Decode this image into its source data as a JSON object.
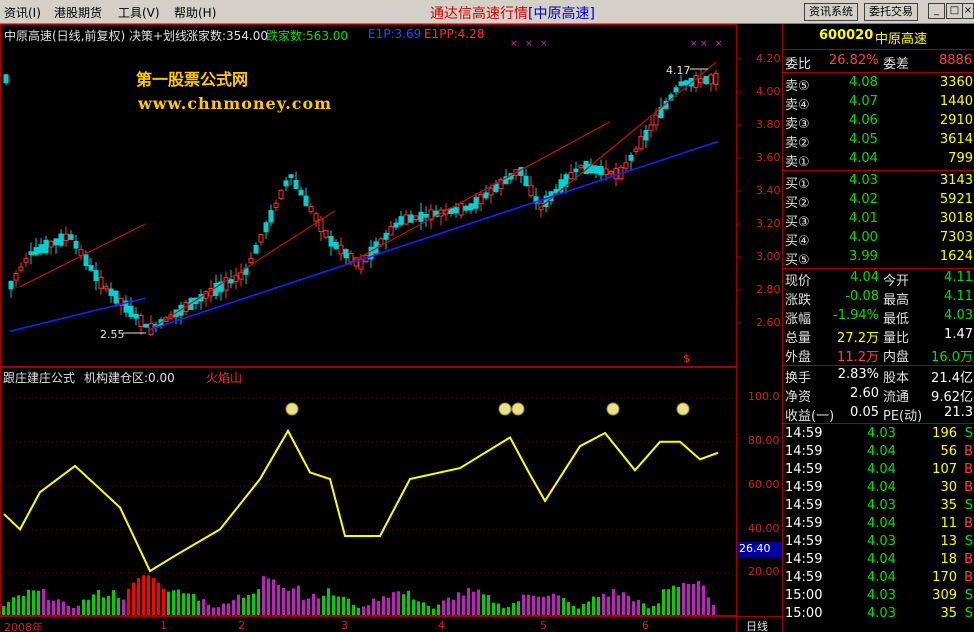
{
  "menu": {
    "items": [
      "资讯(I)",
      "港股期货",
      "工具(V)",
      "帮助(H)"
    ],
    "title_main": "通达信高速行情",
    "title_bracket": "[中原高速]",
    "btn_news": "资讯系统",
    "btn_trade": "委托交易"
  },
  "chart": {
    "header_name": "中原高速(日线,前复权) 决策+划线",
    "header_up": "涨家数:354.00",
    "header_down": "跌家数:563.00",
    "header_e1p": "E1P:3.69",
    "header_e1pp": "E1PP:4.28",
    "watermark_1": "第一股票公式网",
    "watermark_2": "www.chnmoney.com",
    "low_label": "2.55",
    "high_label": "4.17",
    "price_ticks": [
      "4.20",
      "4.00",
      "3.80",
      "3.60",
      "3.40",
      "3.20",
      "3.00",
      "2.80",
      "2.60"
    ],
    "ind_header_name": "跟庄建庄公式",
    "ind_header_zone": "机构建仓区:0.00",
    "ind_header_fire": "火焰山",
    "ind_ticks": [
      "100.0",
      "80.00",
      "60.00",
      "40.00",
      "20.00"
    ],
    "ind_current": "26.40",
    "xaxis": [
      "2008年",
      "1",
      "2",
      "3",
      "4",
      "5",
      "6"
    ],
    "period_label": "日线",
    "colors": {
      "up": "#ff3030",
      "down": "#00d0d0",
      "trend_red": "#c01010",
      "trend_blue": "#2020ff",
      "indicator": "#ffff00",
      "bar_green": "#00d000",
      "bar_purple": "#c020c0",
      "bar_red": "#ff0000"
    }
  },
  "quote": {
    "code": "600020",
    "name": "中原高速",
    "weibi_label": "委比",
    "weibi_value": "26.82%",
    "weicha_label": "委差",
    "weicha_value": "8886",
    "asks": [
      {
        "label": "卖⑤",
        "price": "4.08",
        "vol": "3360"
      },
      {
        "label": "卖④",
        "price": "4.07",
        "vol": "1440"
      },
      {
        "label": "卖③",
        "price": "4.06",
        "vol": "2910"
      },
      {
        "label": "卖②",
        "price": "4.05",
        "vol": "3614"
      },
      {
        "label": "卖①",
        "price": "4.04",
        "vol": "799"
      }
    ],
    "bids": [
      {
        "label": "买①",
        "price": "4.03",
        "vol": "3143"
      },
      {
        "label": "买②",
        "price": "4.02",
        "vol": "5921"
      },
      {
        "label": "买③",
        "price": "4.01",
        "vol": "3018"
      },
      {
        "label": "买④",
        "price": "4.00",
        "vol": "7303"
      },
      {
        "label": "买⑤",
        "price": "3.99",
        "vol": "1624"
      }
    ],
    "stats": [
      {
        "l1": "现价",
        "v1": "4.04",
        "c1": "green",
        "l2": "今开",
        "v2": "4.11",
        "c2": "green"
      },
      {
        "l1": "涨跌",
        "v1": "-0.08",
        "c1": "green",
        "l2": "最高",
        "v2": "4.11",
        "c2": "green"
      },
      {
        "l1": "涨幅",
        "v1": "-1.94%",
        "c1": "green",
        "l2": "最低",
        "v2": "4.03",
        "c2": "green"
      },
      {
        "l1": "总量",
        "v1": "27.2万",
        "c1": "yellow",
        "l2": "量比",
        "v2": "1.47",
        "c2": "white"
      },
      {
        "l1": "外盘",
        "v1": "11.2万",
        "c1": "red",
        "l2": "内盘",
        "v2": "16.0万",
        "c2": "green"
      }
    ],
    "stats2": [
      {
        "l1": "换手",
        "v1": "2.83%",
        "l2": "股本",
        "v2": "21.4亿"
      },
      {
        "l1": "净资",
        "v1": "2.60",
        "l2": "流通",
        "v2": "9.62亿"
      },
      {
        "l1": "收益(一)",
        "v1": "0.05",
        "l2": "PE(动)",
        "v2": "21.3"
      }
    ],
    "ticks": [
      {
        "time": "14:59",
        "price": "4.03",
        "vol": "196",
        "side": "S"
      },
      {
        "time": "14:59",
        "price": "4.04",
        "vol": "56",
        "side": "B"
      },
      {
        "time": "14:59",
        "price": "4.04",
        "vol": "107",
        "side": "B"
      },
      {
        "time": "14:59",
        "price": "4.04",
        "vol": "30",
        "side": "B"
      },
      {
        "time": "14:59",
        "price": "4.03",
        "vol": "35",
        "side": "S"
      },
      {
        "time": "14:59",
        "price": "4.04",
        "vol": "11",
        "side": "B"
      },
      {
        "time": "14:59",
        "price": "4.03",
        "vol": "13",
        "side": "S"
      },
      {
        "time": "14:59",
        "price": "4.04",
        "vol": "18",
        "side": "B"
      },
      {
        "time": "14:59",
        "price": "4.04",
        "vol": "170",
        "side": "B"
      },
      {
        "time": "15:00",
        "price": "4.03",
        "vol": "309",
        "side": "S"
      },
      {
        "time": "15:00",
        "price": "4.03",
        "vol": "35",
        "side": "S"
      }
    ]
  }
}
